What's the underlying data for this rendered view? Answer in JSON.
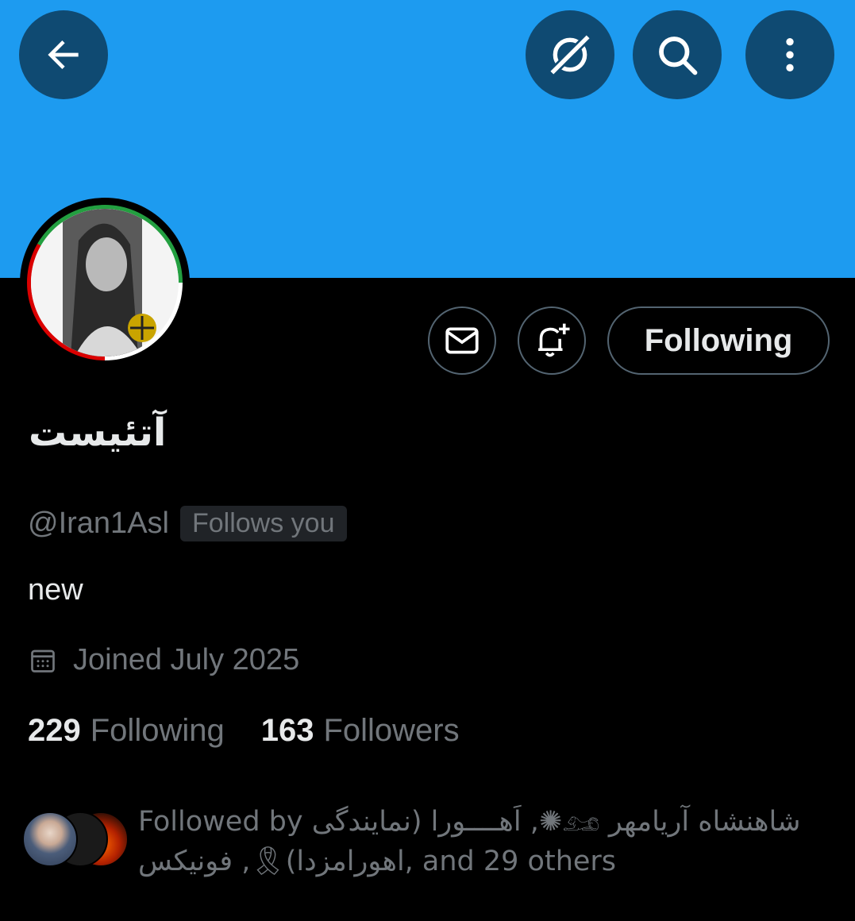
{
  "header": {
    "back_icon": "arrow-left-icon",
    "grok_icon": "grok-icon",
    "search_icon": "search-icon",
    "more_icon": "more-vertical-icon",
    "banner_color": "#1d9bf0"
  },
  "actions": {
    "message_icon": "envelope-icon",
    "notify_icon": "bell-plus-icon",
    "follow_label": "Following"
  },
  "profile": {
    "display_name": "آتئیست",
    "handle": "@Iran1Asl",
    "follows_you": "Follows you",
    "bio": "new",
    "joined": "Joined July 2025",
    "joined_icon": "calendar-icon"
  },
  "stats": {
    "following_count": "229",
    "following_label": "Following",
    "followers_count": "163",
    "followers_label": "Followers"
  },
  "followed_by": {
    "line1": "Followed by اَهــــورا (نمایندگی ,✺𓃭 شاهنشاه آریامهر",
    "line2": "اهورامزدا)🎗, فونیکس, and 29 others"
  }
}
